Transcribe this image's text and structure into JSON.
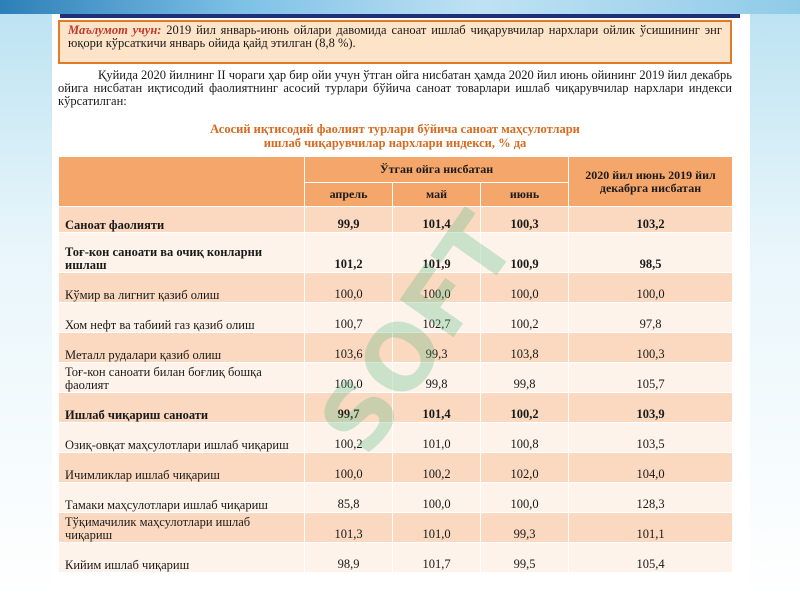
{
  "info_box": {
    "lead": "Маълумот учун:",
    "text": " 2019 йил январь-июнь ойлари давомида саноат ишлаб чиқарувчилар нархлари ойлик ўсишининг энг юқори кўрсаткичи январь ойида қайд этилган (8,8 %)."
  },
  "intro": "Қуйида 2020 йилнинг II чораги ҳар бир ойи учун ўтган ойга нисбатан ҳамда 2020 йил июнь ойининг 2019 йил декабрь ойига нисбатан иқтисодий фаолиятнинг асосий турлари бўйича саноат товарлари ишлаб чиқарувчилар нархлари индекси кўрсатилган:",
  "table_title": {
    "line1": "Асосий иқтисодий фаолият турлари бўйича саноат маҳсулотлари",
    "line2": "ишлаб чиқарувчилар нархлари индекси, % да"
  },
  "table": {
    "group_header": "Ўтган ойга нисбатан",
    "last_header": "2020 йил июнь 2019 йил декабрга нисбатан",
    "months": [
      "апрель",
      "май",
      "июнь"
    ],
    "rows": [
      {
        "label": "Саноат фаолияти",
        "values": [
          "99,9",
          "101,4",
          "100,3",
          "103,2"
        ]
      },
      {
        "label": "Тоғ-кон саноати ва очиқ конларни ишлаш",
        "values": [
          "101,2",
          "101,9",
          "100,9",
          "98,5"
        ]
      },
      {
        "label": "Кўмир ва лигнит қазиб олиш",
        "values": [
          "100,0",
          "100,0",
          "100,0",
          "100,0"
        ]
      },
      {
        "label": "Хом нефт ва табиий газ қазиб олиш",
        "values": [
          "100,7",
          "102,7",
          "100,2",
          "97,8"
        ]
      },
      {
        "label": "Металл рудалари қазиб олиш",
        "values": [
          "103,6",
          "99,3",
          "103,8",
          "100,3"
        ]
      },
      {
        "label": "Тоғ-кон саноати билан боғлиқ бошқа фаолият",
        "values": [
          "100,0",
          "99,8",
          "99,8",
          "105,7"
        ]
      },
      {
        "label": "Ишлаб чиқариш саноати",
        "values": [
          "99,7",
          "101,4",
          "100,2",
          "103,9"
        ]
      },
      {
        "label": "Озиқ-овқат маҳсулотлари ишлаб чиқариш",
        "values": [
          "100,2",
          "101,0",
          "100,8",
          "103,5"
        ]
      },
      {
        "label": "Ичимликлар ишлаб чиқариш",
        "values": [
          "100,0",
          "100,2",
          "102,0",
          "104,0"
        ]
      },
      {
        "label": "Тамаки маҳсулотлари ишлаб чиқариш",
        "values": [
          "85,8",
          "100,0",
          "100,0",
          "128,3"
        ]
      },
      {
        "label": "Тўқимачилик маҳсулотлари ишлаб чиқариш",
        "values": [
          "101,3",
          "101,0",
          "99,3",
          "101,1"
        ]
      },
      {
        "label": "Кийим ишлаб чиқариш",
        "values": [
          "98,9",
          "101,7",
          "99,5",
          "105,4"
        ]
      }
    ]
  },
  "watermark_text": "SOFT",
  "colors": {
    "box_border": "#e07b2a",
    "box_bg": "#fde3c7",
    "lead_red": "#c0392b",
    "title_orange": "#d86a1f",
    "header_bg": "#f5a66a",
    "row_odd": "#fad9c0",
    "row_even": "#fdf3ea"
  }
}
